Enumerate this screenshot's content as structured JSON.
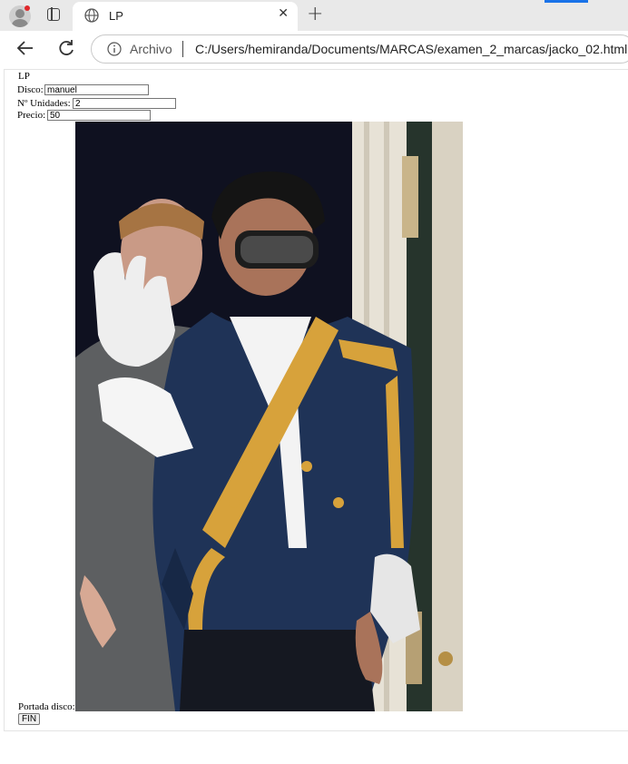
{
  "browser": {
    "tab_title": "LP",
    "omnibox_label": "Archivo",
    "url": "C:/Users/hemiranda/Documents/MARCAS/examen_2_marcas/jacko_02.html",
    "accent_color": "#1a73e8"
  },
  "form": {
    "legend": "LP",
    "disco_label": "Disco:",
    "disco_value": "manuel",
    "unidades_label": "Nº Unidades:",
    "unidades_value": "2",
    "precio_label": "Precio:",
    "precio_value": "50",
    "portada_label": "Portada disco:",
    "fin_label": "FIN"
  },
  "icons": {
    "profile": "profile-icon",
    "tabs": "tab-actions-icon",
    "globe": "globe-icon",
    "close": "close-icon",
    "new_tab": "plus-icon",
    "back": "back-arrow-icon",
    "reload": "reload-icon",
    "info": "info-icon"
  }
}
